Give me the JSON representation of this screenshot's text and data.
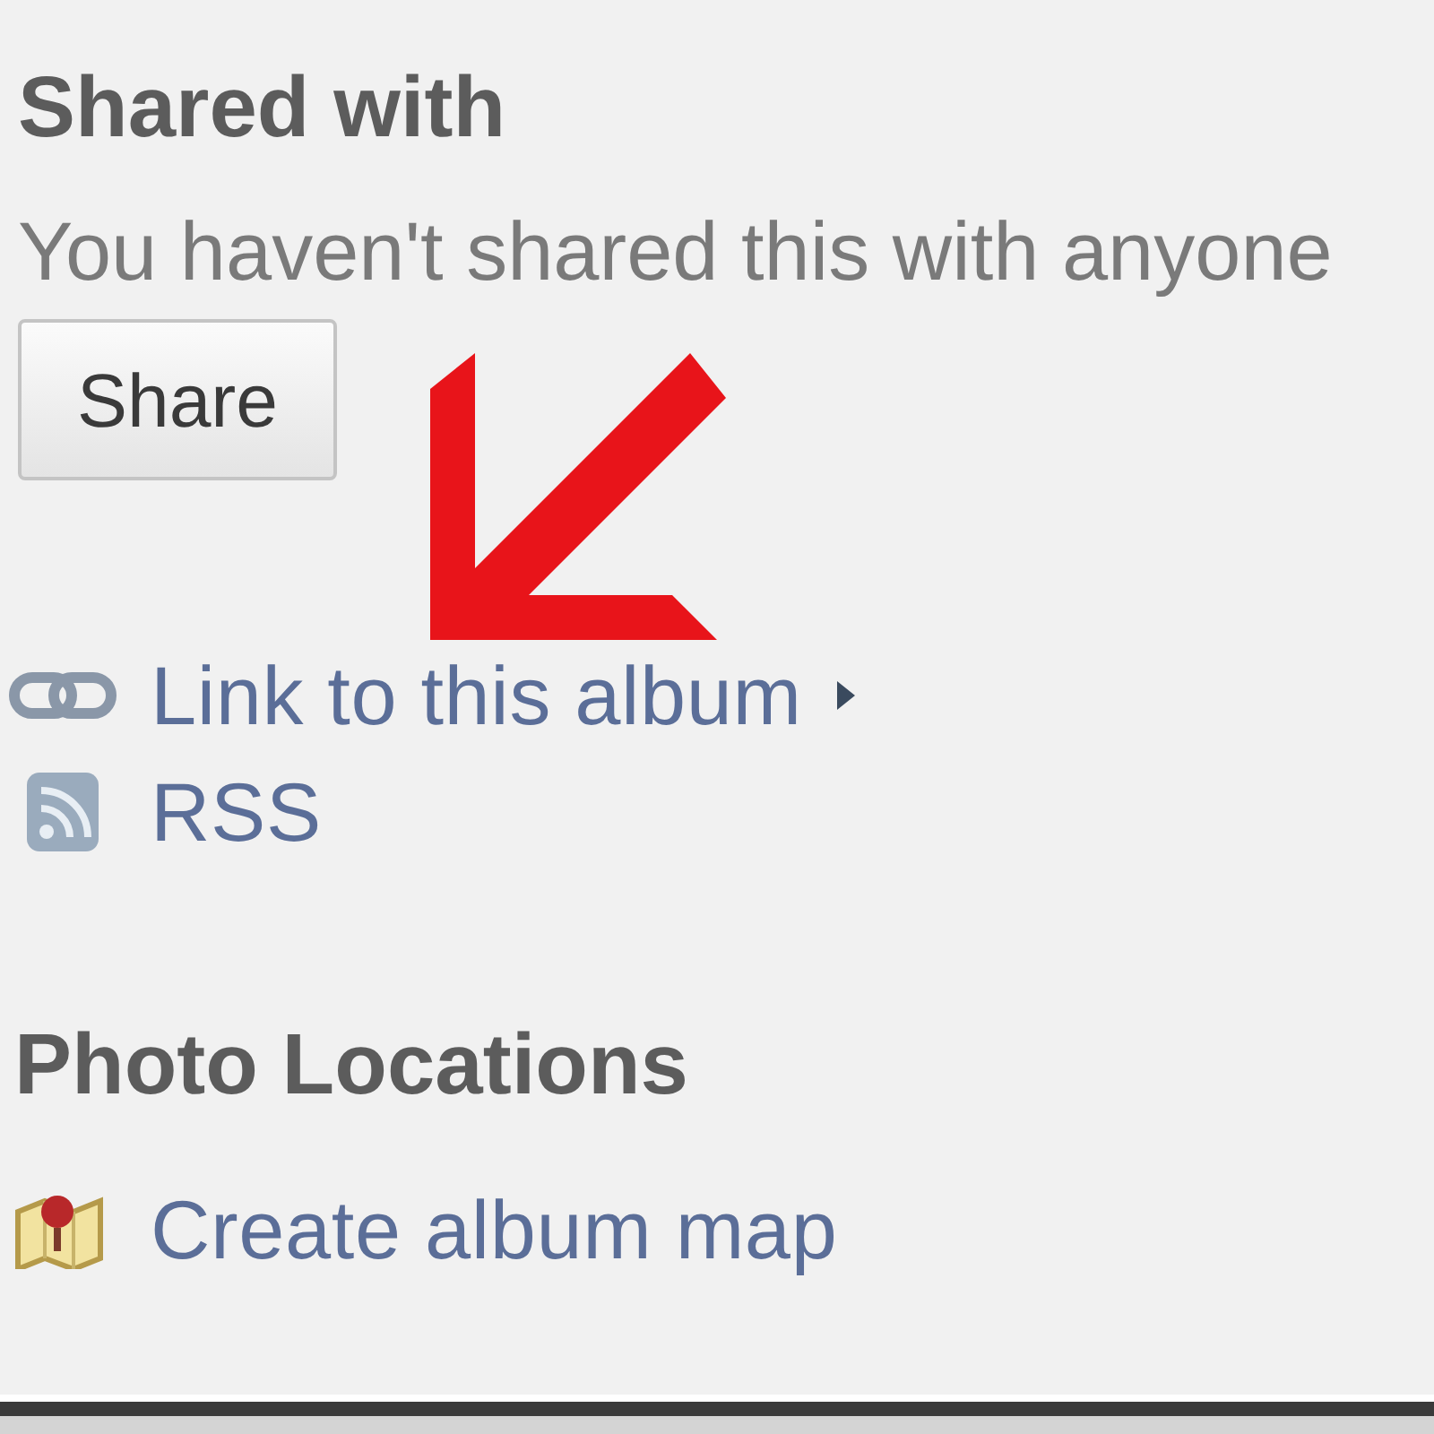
{
  "shared_with": {
    "heading": "Shared with",
    "message": "You haven't shared this with anyone",
    "share_button": "Share"
  },
  "links": [
    {
      "kind": "link",
      "label": "Link to this album",
      "submenu": true
    },
    {
      "kind": "rss",
      "label": "RSS",
      "submenu": false
    }
  ],
  "photo_locations": {
    "heading": "Photo Locations",
    "links": [
      {
        "kind": "map",
        "label": "Create album map",
        "submenu": false
      }
    ]
  }
}
